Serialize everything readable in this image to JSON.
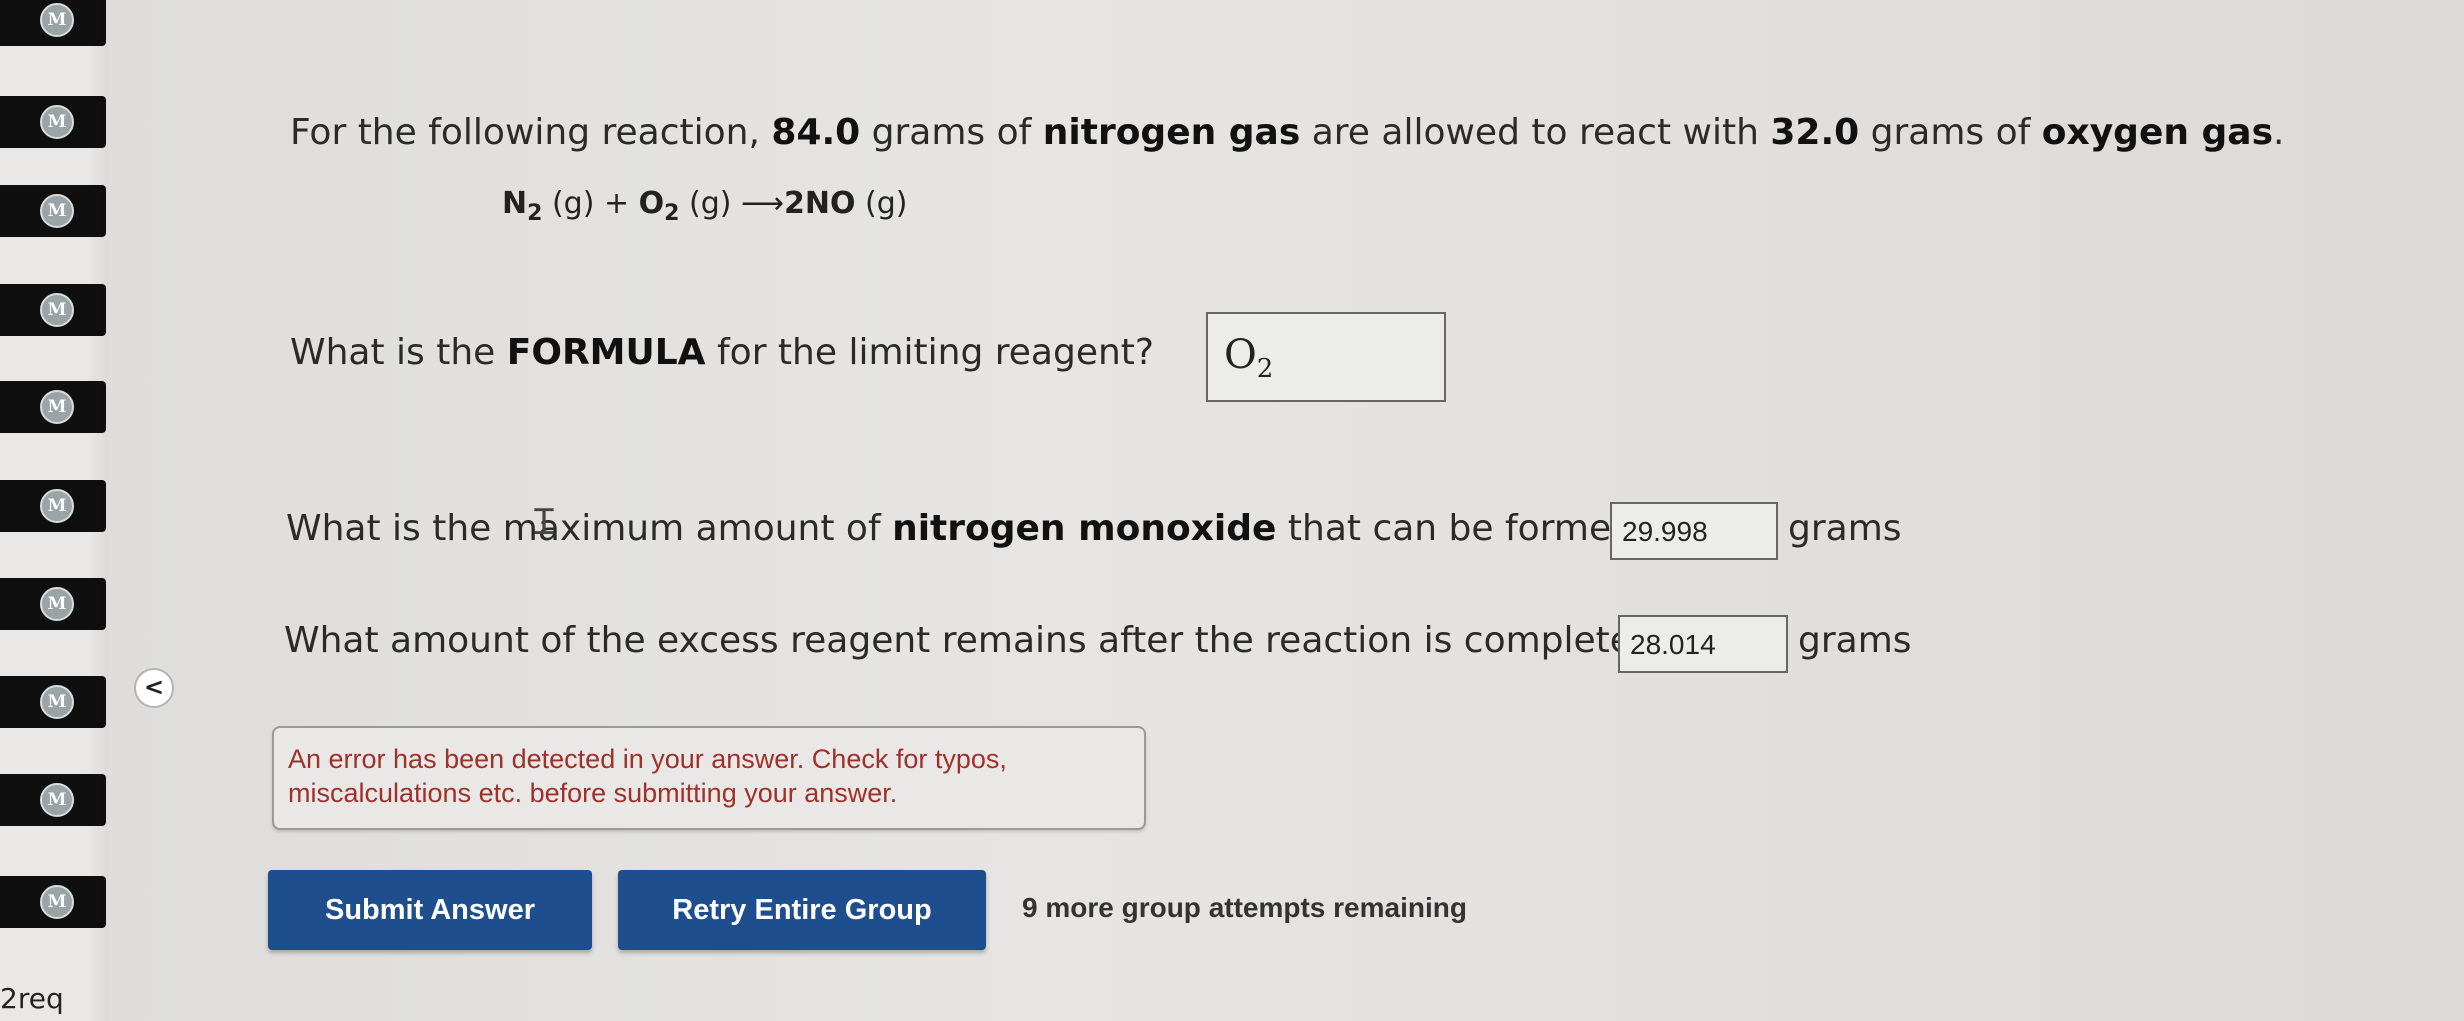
{
  "sidebar": {
    "badge_label": "M",
    "item_count": 10,
    "footer_text": "2req"
  },
  "question": {
    "intro": {
      "prefix": "For the following reaction, ",
      "n2_mass": "84.0",
      "mid1": " grams of ",
      "n2_name": "nitrogen gas",
      "mid2": " are allowed to react with ",
      "o2_mass": "32.0",
      "mid3": " grams of ",
      "o2_name": "oxygen gas",
      "suffix": "."
    },
    "equation": {
      "r1": "N",
      "r1_sub": "2",
      "r1_state": " (g) + ",
      "r2": "O",
      "r2_sub": "2",
      "r2_state": " (g) ",
      "arrow": "⟶",
      "product": "2NO",
      "p_state": " (g)"
    },
    "q1": {
      "prefix": "What is the ",
      "bold": "FORMULA",
      "suffix": " for the limiting reagent?",
      "answer_symbol": "O",
      "answer_sub": "2"
    },
    "q2": {
      "prefix": "What is the maximum amount of ",
      "bold": "nitrogen monoxide",
      "suffix": " that can be formed?",
      "answer": "29.998",
      "unit": "grams"
    },
    "q3": {
      "text": "What amount of the excess reagent remains after the reaction is complete?",
      "answer": "28.014",
      "unit": "grams"
    }
  },
  "error": {
    "line1": "An error has been detected in your answer. Check for typos,",
    "line2": "miscalculations etc. before submitting your answer."
  },
  "actions": {
    "submit_label": "Submit Answer",
    "retry_label": "Retry Entire Group",
    "attempts_text": "9 more group attempts remaining"
  },
  "collapse_glyph": "<",
  "colors": {
    "button": "#1f4e8e",
    "error_text": "#a0302a"
  }
}
